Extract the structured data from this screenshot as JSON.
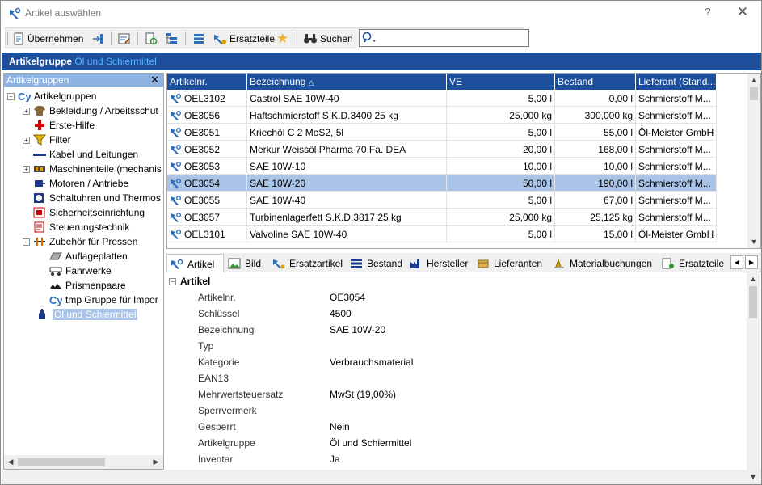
{
  "window": {
    "title": "Artikel auswählen",
    "help_glyph": "?",
    "close_glyph": "✕"
  },
  "toolbar": {
    "uebernehmen": "Übernehmen",
    "ersatzteile": "Ersatzteile",
    "suchen": "Suchen",
    "search_value": ""
  },
  "groupbar": {
    "label": "Artikelgruppe",
    "value": "Öl und Schiermittel"
  },
  "tree": {
    "header": "Artikelgruppen",
    "close_glyph": "✕",
    "root": "Artikelgruppen",
    "items": [
      {
        "label": "Bekleidung / Arbeitsschut",
        "icon": "clothing-icon",
        "expander": "+"
      },
      {
        "label": "Erste-Hilfe",
        "icon": "first-aid-icon",
        "expander": ""
      },
      {
        "label": "Filter",
        "icon": "filter-icon",
        "expander": "+"
      },
      {
        "label": "Kabel und Leitungen",
        "icon": "cable-icon",
        "expander": ""
      },
      {
        "label": "Maschinenteile (mechanis",
        "icon": "machine-parts-icon",
        "expander": "+"
      },
      {
        "label": "Motoren / Antriebe",
        "icon": "motor-icon",
        "expander": ""
      },
      {
        "label": "Schaltuhren und Thermos",
        "icon": "timer-icon",
        "expander": ""
      },
      {
        "label": "Sicherheitseinrichtung",
        "icon": "safety-icon",
        "expander": ""
      },
      {
        "label": "Steuerungstechnik",
        "icon": "control-icon",
        "expander": ""
      },
      {
        "label": "Zubehör für Pressen",
        "icon": "press-accessory-icon",
        "expander": "−"
      }
    ],
    "subitems": [
      {
        "label": "Auflageplatten",
        "icon": "plate-icon"
      },
      {
        "label": "Fahrwerke",
        "icon": "chassis-icon"
      },
      {
        "label": "Prismenpaare",
        "icon": "prism-icon"
      },
      {
        "label": "tmp Gruppe für Impor",
        "icon": "group-icon"
      }
    ],
    "selected": "Öl und Schiermittel"
  },
  "grid": {
    "columns": [
      "Artikelnr.",
      "Bezeichnung",
      "VE",
      "Bestand",
      "Lieferant (Stand..."
    ],
    "sort_glyph": "△",
    "rows": [
      [
        "OEL3102",
        "Castrol SAE 10W-40",
        "5,00 l",
        "0,00 l",
        "Schmierstoff M..."
      ],
      [
        "OE3056",
        "Haftschmierstoff S.K.D.3400 25 kg",
        "25,000 kg",
        "300,000 kg",
        "Schmierstoff M..."
      ],
      [
        "OE3051",
        "Kriechöl C 2 MoS2, 5l",
        "5,00 l",
        "55,00 l",
        "Öl-Meister GmbH"
      ],
      [
        "OE3052",
        "Merkur Weissöl Pharma 70 Fa. DEA",
        "20,00 l",
        "168,00 l",
        "Schmierstoff M..."
      ],
      [
        "OE3053",
        "SAE 10W-10",
        "10,00 l",
        "10,00 l",
        "Schmierstoff M..."
      ],
      [
        "OE3054",
        "SAE 10W-20",
        "50,00 l",
        "190,00 l",
        "Schmierstoff M..."
      ],
      [
        "OE3055",
        "SAE 10W-40",
        "5,00 l",
        "67,00 l",
        "Schmierstoff M..."
      ],
      [
        "OE3057",
        "Turbinenlagerfett S.K.D.3817 25 kg",
        "25,000 kg",
        "25,125 kg",
        "Schmierstoff M..."
      ],
      [
        "OEL3101",
        "Valvoline SAE 10W-40",
        "5,00 l",
        "15,00 l",
        "Öl-Meister GmbH"
      ]
    ],
    "selected_row": 5
  },
  "tabs": [
    "Artikel",
    "Bild",
    "Ersatzartikel",
    "Bestand",
    "Hersteller",
    "Lieferanten",
    "Materialbuchungen",
    "Ersatzteile"
  ],
  "detail": {
    "section": "Artikel",
    "fields": [
      {
        "label": "Artikelnr.",
        "value": "OE3054"
      },
      {
        "label": "Schlüssel",
        "value": "4500"
      },
      {
        "label": "Bezeichnung",
        "value": "SAE 10W-20"
      },
      {
        "label": "Typ",
        "value": ""
      },
      {
        "label": "Kategorie",
        "value": "Verbrauchsmaterial"
      },
      {
        "label": "EAN13",
        "value": ""
      },
      {
        "label": "Mehrwertsteuersatz",
        "value": "MwSt (19,00%)"
      },
      {
        "label": "Sperrvermerk",
        "value": ""
      },
      {
        "label": "Gesperrt",
        "value": "Nein"
      },
      {
        "label": "Artikelgruppe",
        "value": "Öl und Schiermittel"
      },
      {
        "label": "Inventar",
        "value": "Ja"
      }
    ]
  },
  "colors": {
    "header_blue": "#1d4f9d",
    "selection": "#aac4e8",
    "tree_header": "#8eb4e3",
    "accent_link": "#5ab4ff"
  }
}
